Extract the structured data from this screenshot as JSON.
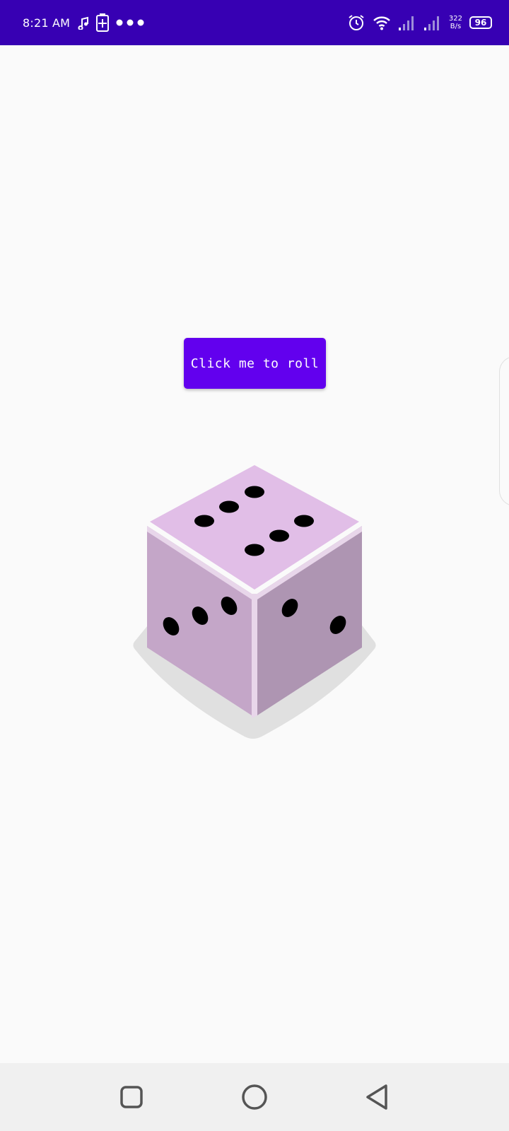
{
  "status_bar": {
    "time": "8:21 AM",
    "net_speed_value": "322",
    "net_speed_unit": "B/s",
    "battery": "96",
    "background": "#3700b3"
  },
  "main": {
    "roll_button_label": "Click me to roll",
    "button_color": "#6200ee",
    "dice": {
      "top_pips": 6,
      "left_pips": 3,
      "right_pips": 2
    }
  },
  "nav": {
    "icons": [
      "recents-square-icon",
      "home-circle-icon",
      "back-triangle-icon"
    ]
  }
}
